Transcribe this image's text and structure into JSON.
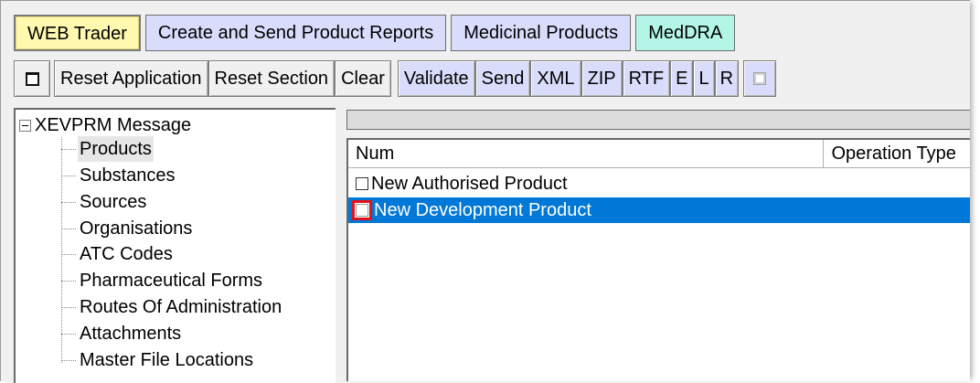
{
  "tabs": [
    {
      "label": "WEB Trader",
      "color": "#fff9b0"
    },
    {
      "label": "Create and Send Product Reports",
      "color": "#dadcfb"
    },
    {
      "label": "Medicinal Products",
      "color": "#dadcfb"
    },
    {
      "label": "MedDRA",
      "color": "#b3f5e6"
    }
  ],
  "toolbar": {
    "window_icon": "window-icon",
    "reset_application": "Reset Application",
    "reset_section": "Reset Section",
    "clear": "Clear",
    "validate": "Validate",
    "send": "Send",
    "xml": "XML",
    "zip": "ZIP",
    "rtf": "RTF",
    "e": "E",
    "l": "L",
    "r": "R",
    "disabled_checkbox_icon": "checkbox-icon"
  },
  "tree": {
    "root": "XEVPRM Message",
    "items": [
      "Products",
      "Substances",
      "Sources",
      "Organisations",
      "ATC Codes",
      "Pharmaceutical Forms",
      "Routes Of Administration",
      "Attachments",
      "Master File Locations"
    ],
    "selected": "Products"
  },
  "grid": {
    "columns": [
      "Num",
      "Operation Type"
    ],
    "rows": [
      {
        "label": "New Authorised Product",
        "checked": false,
        "selected": false
      },
      {
        "label": "New Development Product",
        "checked": false,
        "selected": true
      }
    ],
    "selection_color": "#0078d7",
    "highlight_color": "#e0141e"
  }
}
